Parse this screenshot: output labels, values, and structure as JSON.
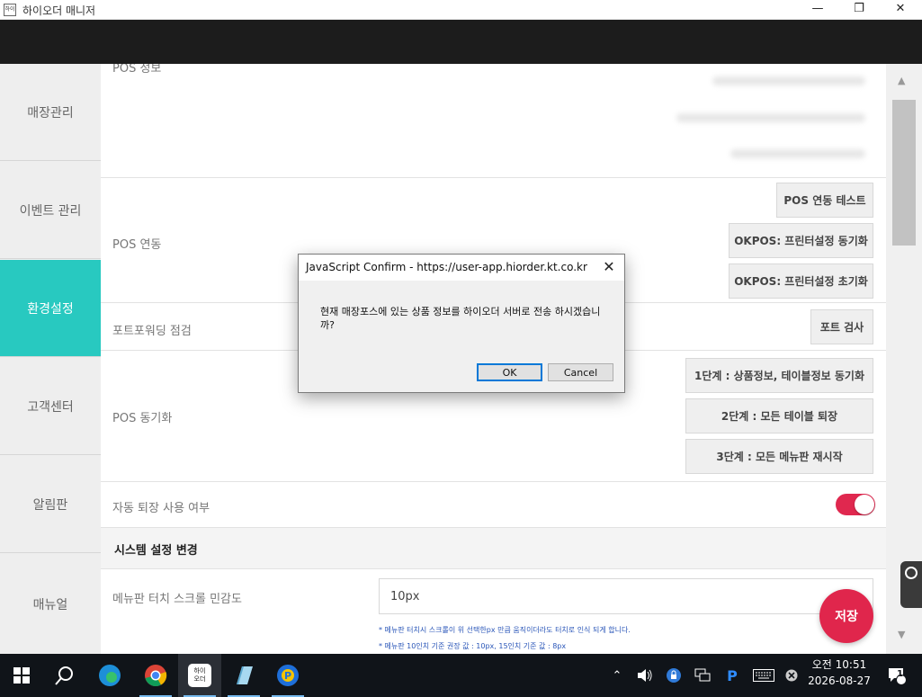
{
  "window": {
    "title": "하이오더 매니저",
    "app_icon_text": "하이"
  },
  "sidebar": {
    "items": [
      {
        "label": "매장관리",
        "active": false
      },
      {
        "label": "이벤트 관리",
        "active": false
      },
      {
        "label": "환경설정",
        "active": true
      },
      {
        "label": "고객센터",
        "active": false
      },
      {
        "label": "알림판",
        "active": false
      },
      {
        "label": "매뉴얼",
        "active": false
      }
    ],
    "accent_color": "#28c9c0"
  },
  "main": {
    "pos_info_label": "POS 정보",
    "pos_link": {
      "label": "POS 연동",
      "buttons": [
        "POS 연동 테스트",
        "OKPOS: 프린터설정 동기화",
        "OKPOS: 프린터설정 초기화"
      ]
    },
    "port_forward": {
      "label": "포트포워딩 점검",
      "button": "포트 검사"
    },
    "pos_sync": {
      "label": "POS 동기화",
      "buttons": [
        "1단계 : 상품정보, 테이블정보 동기화",
        "2단계 : 모든 테이블 퇴장",
        "3단계 : 모든 메뉴판 재시작"
      ]
    },
    "auto_exit": {
      "label": "자동 퇴장 사용 여부",
      "toggle_on": true
    },
    "system_settings": {
      "heading": "시스템 설정 변경",
      "scroll_label": "메뉴판 터치 스크롤 민감도",
      "scroll_value": "10px",
      "note1": "* 메뉴판 터치시 스크롤이 위 선택한px 만큼 움직이더라도 터치로 인식 되게 합니다.",
      "note2": "* 메뉴판 10인치 기준 권장 값 : 10px, 15인치 기준 값 : 8px"
    },
    "save_button": "저장",
    "save_color": "#e0264c"
  },
  "dialog": {
    "title": "JavaScript Confirm - https://user-app.hiorder.kt.co.kr",
    "message": "현재 매장포스에 있는 상품 정보를 하이오더 서버로 전송 하시겠습니까?",
    "ok": "OK",
    "cancel": "Cancel"
  },
  "taskbar": {
    "hiorder_icon_text": "하이\n오더",
    "tray_letter": "P",
    "time": "오전 10:51",
    "date": "2026-08-27",
    "notification_count": "1"
  }
}
